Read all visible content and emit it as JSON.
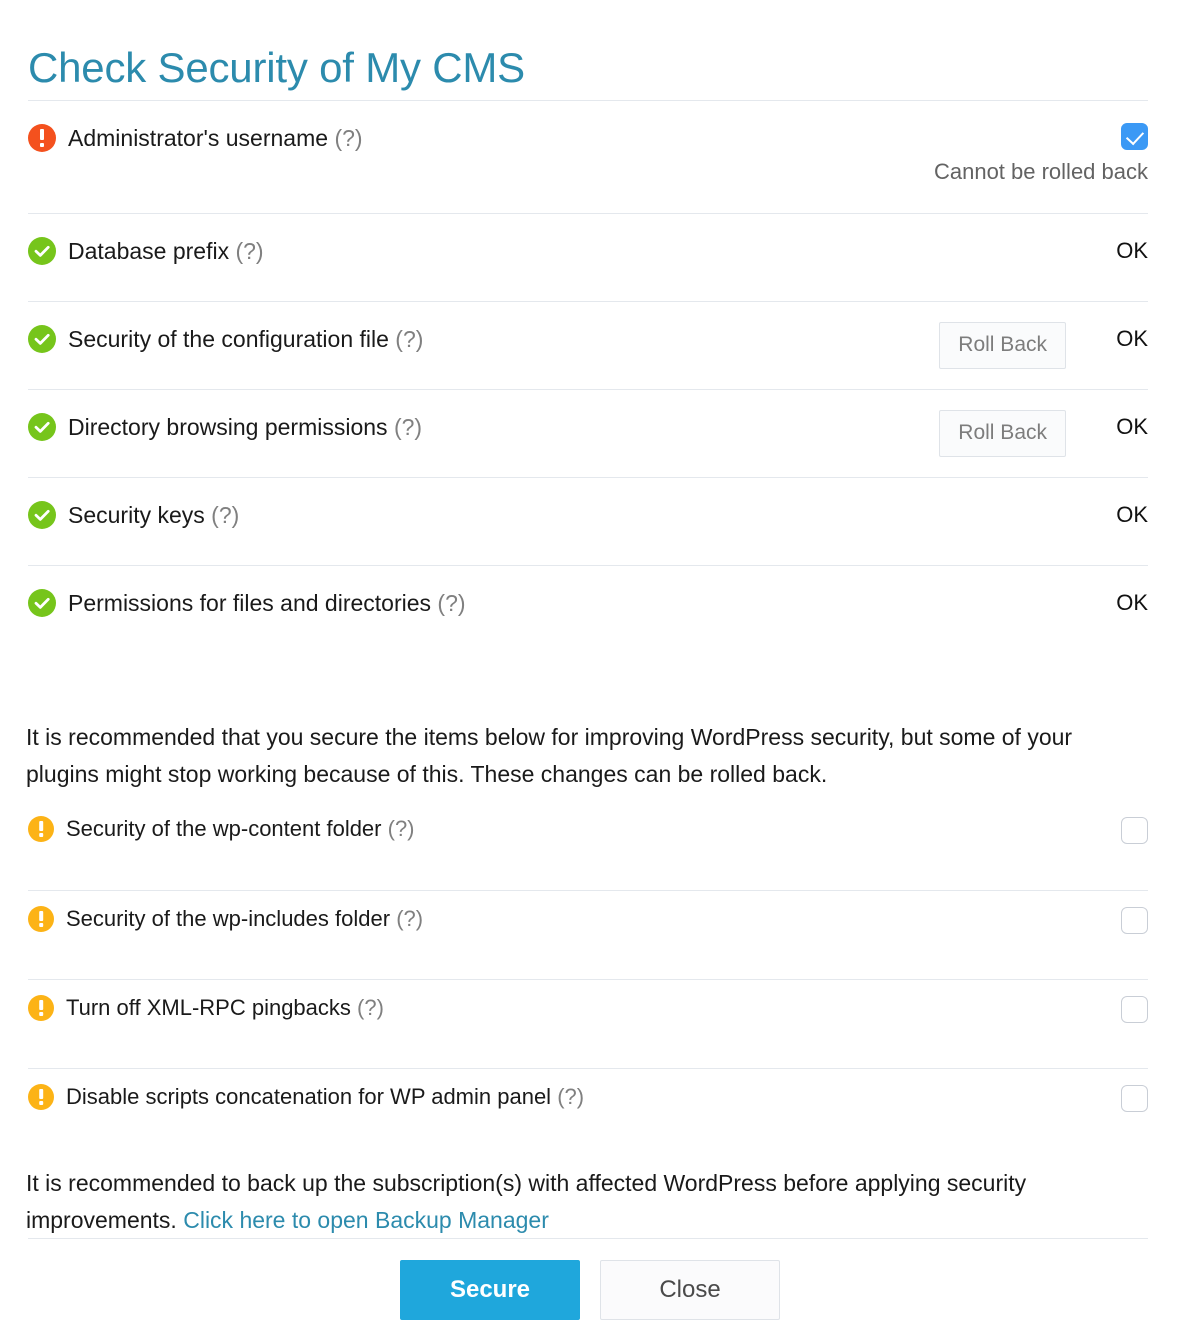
{
  "page": {
    "title": "Check Security of My CMS",
    "hint_marker": "(?)",
    "accent_color": "#2c8bad",
    "primary_button_color": "#1fa7dc",
    "status_colors": {
      "error": "#f4511e",
      "warning": "#fcb316",
      "ok": "#76c51b",
      "checkbox_checked": "#3b99f5"
    }
  },
  "checks": [
    {
      "label": "Administrator's username",
      "hint": "(?)",
      "icon": "error-exclamation-icon",
      "control": "checkbox",
      "checked": true,
      "note": "Cannot be rolled back"
    },
    {
      "label": "Database prefix",
      "hint": "(?)",
      "icon": "check-circle-icon",
      "control": "status",
      "status": "OK"
    },
    {
      "label": "Security of the configuration file",
      "hint": "(?)",
      "icon": "check-circle-icon",
      "control": "rollback",
      "rollback_label": "Roll Back",
      "status": "OK"
    },
    {
      "label": "Directory browsing permissions",
      "hint": "(?)",
      "icon": "check-circle-icon",
      "control": "rollback",
      "rollback_label": "Roll Back",
      "status": "OK"
    },
    {
      "label": "Security keys",
      "hint": "(?)",
      "icon": "check-circle-icon",
      "control": "status",
      "status": "OK"
    },
    {
      "label": "Permissions for files and directories",
      "hint": "(?)",
      "icon": "check-circle-icon",
      "control": "status",
      "status": "OK"
    }
  ],
  "recommendation_top": "It is recommended that you secure the items below for improving WordPress security, but some of your plugins might stop working because of this. These changes can be rolled back.",
  "optional_checks": [
    {
      "label": "Security of the wp-content folder",
      "hint": "(?)",
      "icon": "warning-exclamation-icon",
      "checked": false
    },
    {
      "label": "Security of the wp-includes folder",
      "hint": "(?)",
      "icon": "warning-exclamation-icon",
      "checked": false
    },
    {
      "label": "Turn off XML-RPC pingbacks",
      "hint": "(?)",
      "icon": "warning-exclamation-icon",
      "checked": false
    },
    {
      "label": "Disable scripts concatenation for WP admin panel",
      "hint": "(?)",
      "icon": "warning-exclamation-icon",
      "checked": false
    }
  ],
  "backup_notice": {
    "text": "It is recommended to back up the subscription(s) with affected WordPress before applying security improvements. ",
    "link_text": "Click here to open Backup Manager"
  },
  "footer": {
    "secure_label": "Secure",
    "close_label": "Close"
  }
}
